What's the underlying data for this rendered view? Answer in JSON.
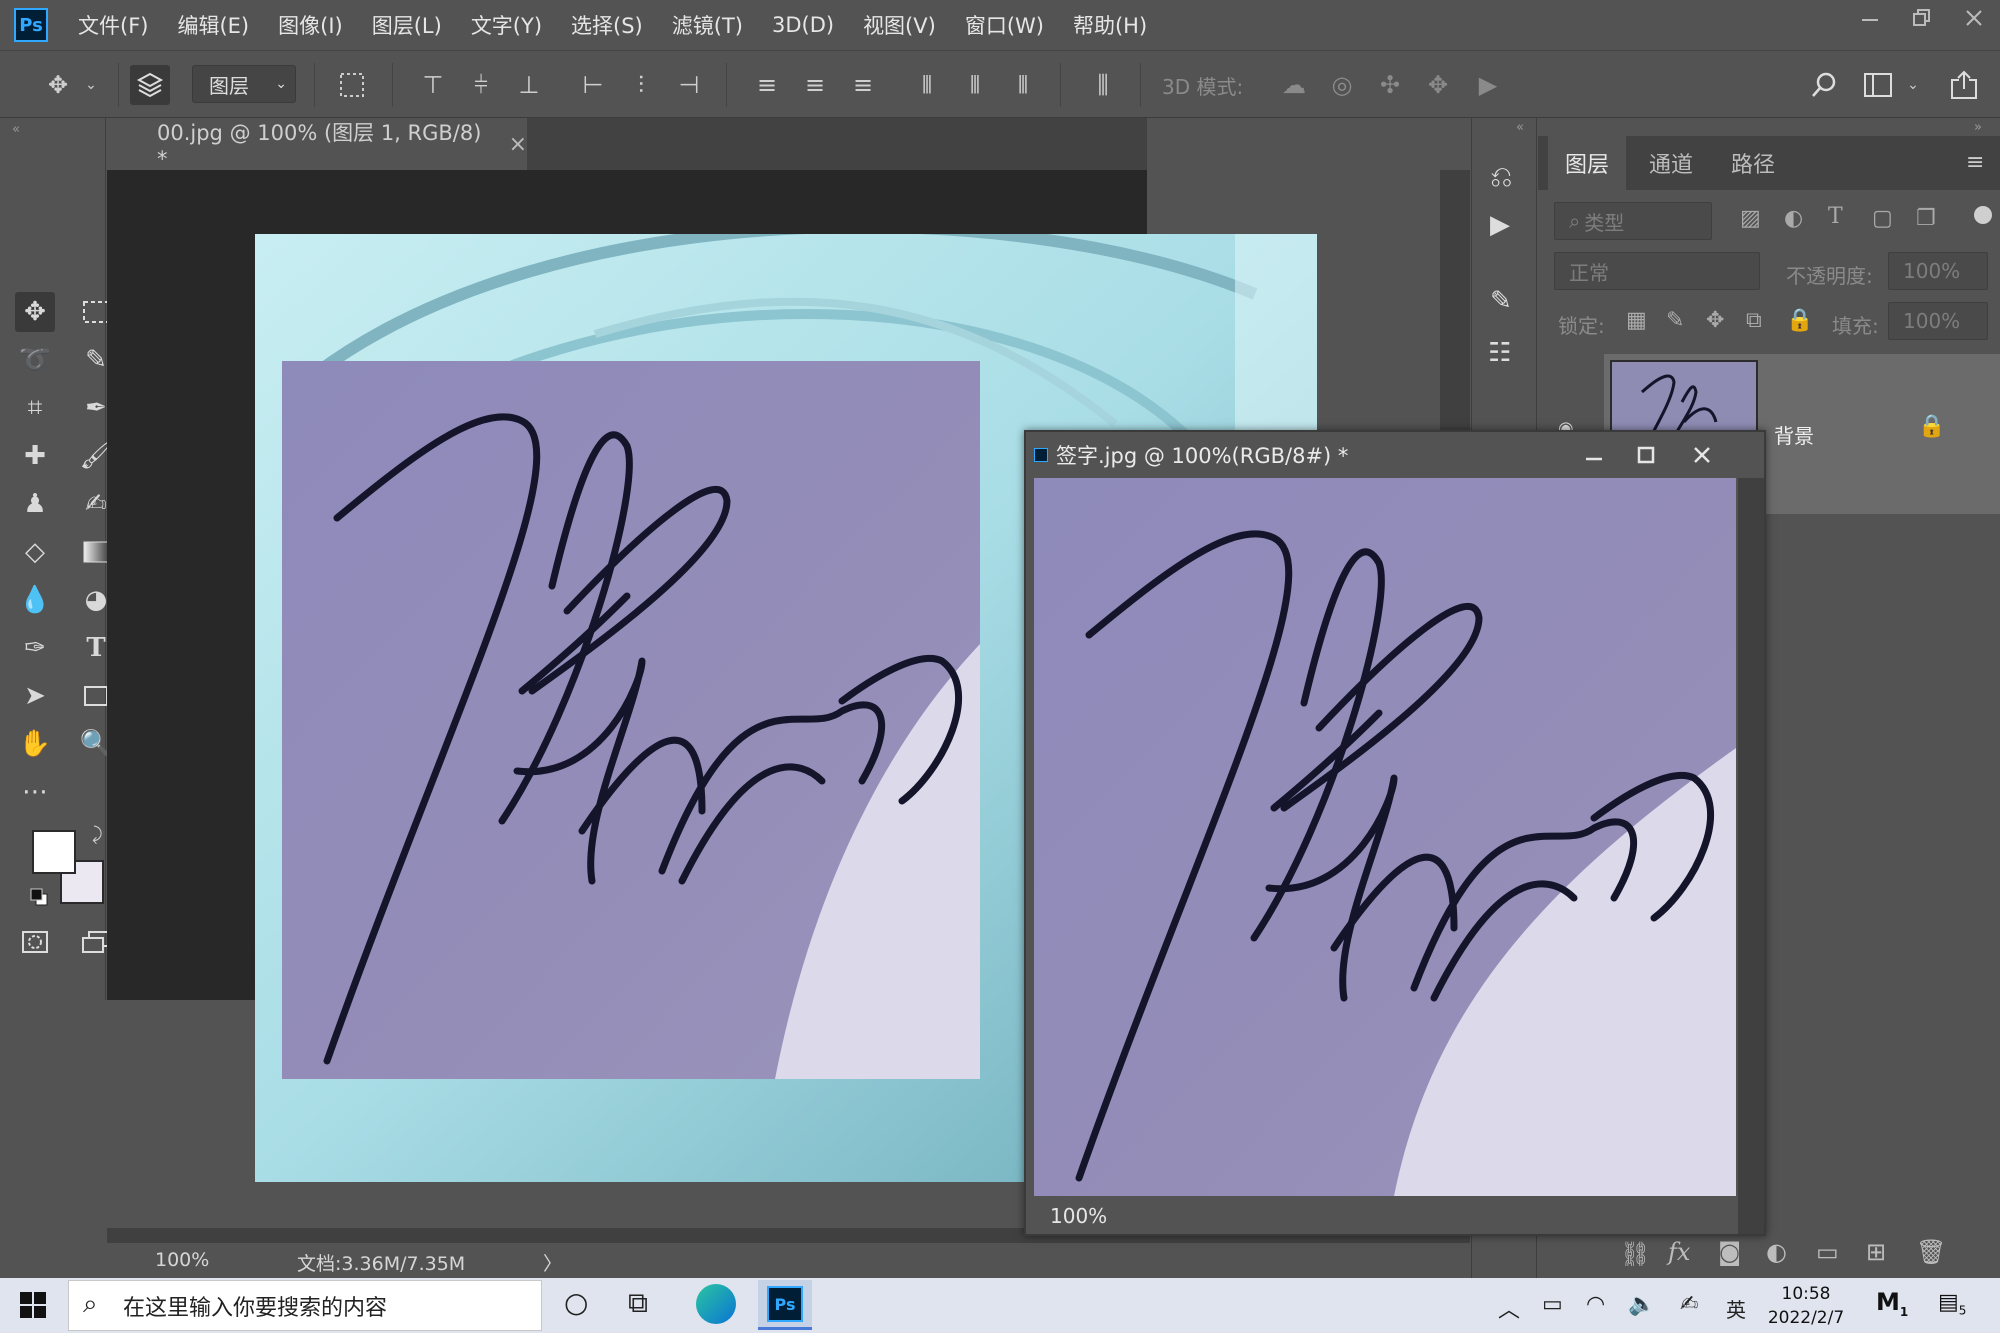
{
  "app": {
    "logo": "Ps"
  },
  "menu": [
    "文件(F)",
    "编辑(E)",
    "图像(I)",
    "图层(L)",
    "文字(Y)",
    "选择(S)",
    "滤镜(T)",
    "3D(D)",
    "视图(V)",
    "窗口(W)",
    "帮助(H)"
  ],
  "options_bar": {
    "layer_select": "图层",
    "mode_3d": "3D 模式:"
  },
  "document_tab": {
    "title": "00.jpg @ 100% (图层 1, RGB/8) *",
    "close": "×"
  },
  "document_status": {
    "zoom": "100%",
    "doc_size": "文档:3.36M/7.35M",
    "arrow": "〉"
  },
  "layers_panel": {
    "tabs": [
      "图层",
      "通道",
      "路径"
    ],
    "filter_placeholder": "类型",
    "blend_mode": "正常",
    "opacity_label": "不透明度:",
    "opacity_value": "100%",
    "lock_label": "锁定:",
    "fill_label": "填充:",
    "fill_value": "100%",
    "layer_name": "背景",
    "fx_label": "fx"
  },
  "floating_window": {
    "title": "签字.jpg @ 100%(RGB/8#) *",
    "zoom": "100%"
  },
  "taskbar": {
    "search_placeholder": "在这里输入你要搜索的内容",
    "ime": "英",
    "time": "10:58",
    "date": "2022/2/7",
    "notification_count": "5",
    "badge_count": "1"
  },
  "colors": {
    "panel_bg": "#535353",
    "canvas_bg": "#282828",
    "signature_bg": "#8f8cb4",
    "signature_ink": "#14142a",
    "background_teal": "#9fd3de",
    "accent_blue": "#31a8ff"
  }
}
